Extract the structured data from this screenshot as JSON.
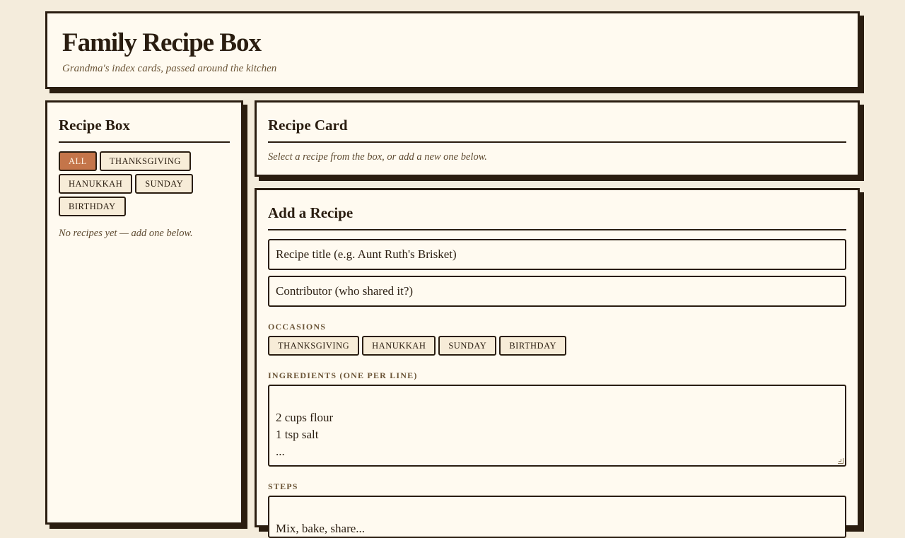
{
  "header": {
    "title": "Family Recipe Box",
    "subtitle": "Grandma's index cards, passed around the kitchen"
  },
  "sidebar": {
    "title": "Recipe Box",
    "filters": [
      "ALL",
      "THANKSGIVING",
      "HANUKKAH",
      "SUNDAY",
      "BIRTHDAY"
    ],
    "active_filter": "ALL",
    "empty_message": "No recipes yet — add one below."
  },
  "recipe_card": {
    "title": "Recipe Card",
    "hint": "Select a recipe from the box, or add a new one below."
  },
  "add_recipe": {
    "title": "Add a Recipe",
    "title_placeholder": "Recipe title (e.g. Aunt Ruth's Brisket)",
    "contributor_placeholder": "Contributor (who shared it?)",
    "occasions_label": "OCCASIONS",
    "occasions": [
      "THANKSGIVING",
      "HANUKKAH",
      "SUNDAY",
      "BIRTHDAY"
    ],
    "ingredients_label": "INGREDIENTS (ONE PER LINE)",
    "ingredients_placeholder": "2 cups flour\n1 tsp salt\n...",
    "steps_label": "STEPS",
    "steps_placeholder": "Mix, bake, share..."
  },
  "colors": {
    "background": "#f4ecdc",
    "panel": "#fffaf0",
    "ink": "#2a1d10",
    "accent": "#c4754a",
    "chip": "#f7ecd8"
  }
}
